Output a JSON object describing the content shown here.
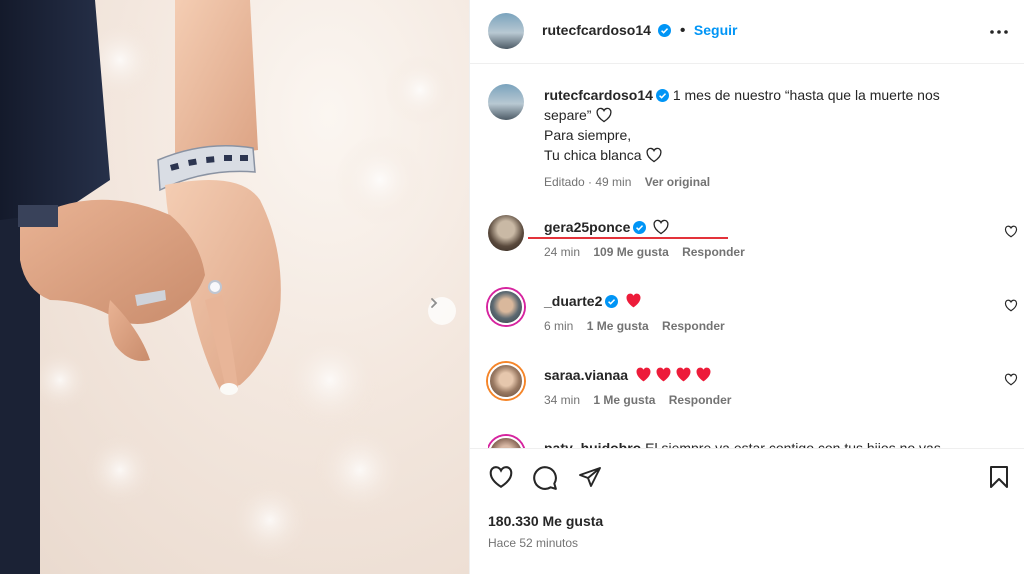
{
  "post": {
    "author": "rutecfcardoso14",
    "follow_label": "Seguir",
    "caption": {
      "author": "rutecfcardoso14",
      "line1": "1 mes de nuestro “hasta que la muerte nos",
      "line2": "separe”",
      "line3": "Para siempre,",
      "line4": "Tu chica blanca",
      "edited": "Editado · 49 min",
      "view_original": "Ver original"
    }
  },
  "comments": [
    {
      "user": "gera25ponce",
      "verified": true,
      "text": "",
      "time": "24 min",
      "likes": "109 Me gusta",
      "reply": "Responder"
    },
    {
      "user": "_duarte2",
      "verified": true,
      "text": "",
      "time": "6 min",
      "likes": "1 Me gusta",
      "reply": "Responder"
    },
    {
      "user": "saraa.vianaa",
      "verified": false,
      "text": "",
      "time": "34 min",
      "likes": "1 Me gusta",
      "reply": "Responder"
    },
    {
      "user": "paty_huidobro",
      "verified": false,
      "text": "El siempre va estar contigo con tus hijos no vas",
      "time": "",
      "likes": "",
      "reply": ""
    }
  ],
  "footer": {
    "likes": "180.330 Me gusta",
    "time_ago": "Hace 52 minutos"
  },
  "colors": {
    "accent": "#0095f6",
    "verified": "#0095f6",
    "heart": "#ed1c3a",
    "underline": "#e3323a"
  },
  "icons": [
    "more-icon",
    "verified-icon",
    "heart-outline-icon",
    "heart-red-icon",
    "comment-icon",
    "share-icon",
    "bookmark-icon",
    "chevron-right-icon"
  ]
}
